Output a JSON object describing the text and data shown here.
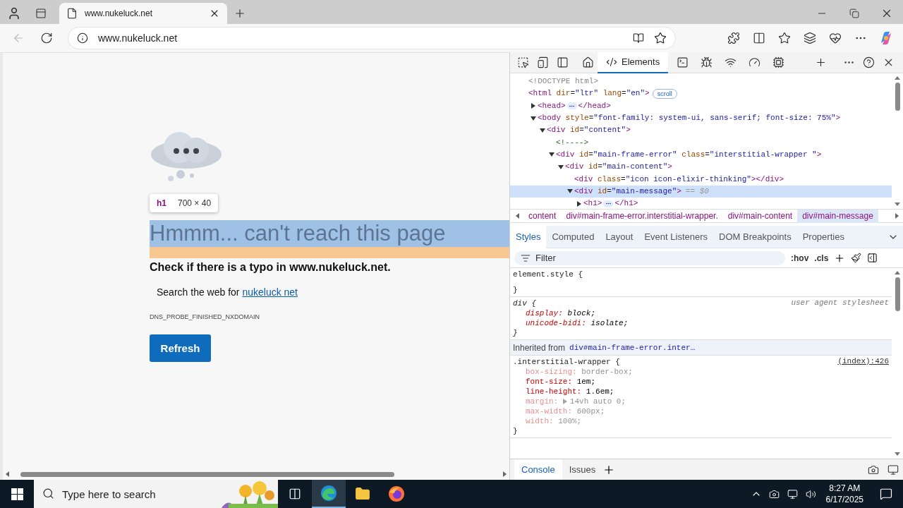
{
  "browser": {
    "tab": {
      "title": "www.nukeluck.net",
      "selected": true
    },
    "address": "www.nukeluck.net"
  },
  "page": {
    "tooltip": {
      "tag": "h1",
      "size": "700 × 40"
    },
    "heading": "Hmmm... can't reach this page",
    "subheading": "Check if there is a typo in www.nukeluck.net.",
    "search_text": "Search the web for",
    "search_link": "nukeluck net",
    "error_code": "DNS_PROBE_FINISHED_NXDOMAIN",
    "button": "Refresh"
  },
  "devtools": {
    "tool_tabs": [
      {
        "label": "Elements",
        "selected": true
      }
    ],
    "dom_tree": [
      {
        "tokens": [
          {
            "kind": "doctype",
            "text": "<!DOCTYPE html>"
          }
        ]
      },
      {
        "tokens": [
          {
            "kind": "tag",
            "text": "<html"
          },
          {
            "kind": "attr",
            "text": "dir"
          },
          {
            "kind": "punct",
            "text": "="
          },
          {
            "kind": "value",
            "text": "\"ltr\""
          },
          {
            "kind": "attr",
            "text": "lang"
          },
          {
            "kind": "punct",
            "text": "="
          },
          {
            "kind": "value",
            "text": "\"en\""
          },
          {
            "kind": "tag",
            "text": ">"
          }
        ],
        "badge": "scroll",
        "children": [
          {
            "expanded": false,
            "tokens": [
              {
                "kind": "tag",
                "text": "<head>"
              },
              {
                "kind": "ellipsis"
              },
              {
                "kind": "tag",
                "text": "</head>"
              }
            ]
          },
          {
            "expanded": true,
            "tokens": [
              {
                "kind": "tag",
                "text": "<body"
              },
              {
                "kind": "attr",
                "text": "style"
              },
              {
                "kind": "punct",
                "text": "="
              },
              {
                "kind": "value",
                "text": "\"font-family: system-ui, sans-serif; font-size: 75%\""
              },
              {
                "kind": "tag",
                "text": ">"
              }
            ],
            "children": [
              {
                "expanded": true,
                "tokens": [
                  {
                    "kind": "tag",
                    "text": "<div"
                  },
                  {
                    "kind": "attr",
                    "text": "id"
                  },
                  {
                    "kind": "punct",
                    "text": "="
                  },
                  {
                    "kind": "value",
                    "text": "\"content\""
                  },
                  {
                    "kind": "tag",
                    "text": ">"
                  }
                ],
                "children": [
                  {
                    "tokens": [
                      {
                        "kind": "comment",
                        "text": "<!---->"
                      }
                    ]
                  },
                  {
                    "expanded": true,
                    "tokens": [
                      {
                        "kind": "tag",
                        "text": "<div"
                      },
                      {
                        "kind": "attr",
                        "text": "id"
                      },
                      {
                        "kind": "punct",
                        "text": "="
                      },
                      {
                        "kind": "value",
                        "text": "\"main-frame-error\""
                      },
                      {
                        "kind": "attr",
                        "text": "class"
                      },
                      {
                        "kind": "punct",
                        "text": "="
                      },
                      {
                        "kind": "value",
                        "text": "\"interstitial-wrapper \""
                      },
                      {
                        "kind": "tag",
                        "text": ">"
                      }
                    ],
                    "children": [
                      {
                        "expanded": true,
                        "tokens": [
                          {
                            "kind": "tag",
                            "text": "<div"
                          },
                          {
                            "kind": "attr",
                            "text": "id"
                          },
                          {
                            "kind": "punct",
                            "text": "="
                          },
                          {
                            "kind": "value",
                            "text": "\"main-content\""
                          },
                          {
                            "kind": "tag",
                            "text": ">"
                          }
                        ],
                        "children": [
                          {
                            "tokens": [
                              {
                                "kind": "tag",
                                "text": "<div"
                              },
                              {
                                "kind": "attr",
                                "text": "class"
                              },
                              {
                                "kind": "punct",
                                "text": "="
                              },
                              {
                                "kind": "value",
                                "text": "\"icon icon-elixir-thinking\""
                              },
                              {
                                "kind": "tag",
                                "text": "></div>"
                              }
                            ]
                          },
                          {
                            "expanded": true,
                            "selected": true,
                            "suffix": "== $0",
                            "tokens": [
                              {
                                "kind": "tag",
                                "text": "<div"
                              },
                              {
                                "kind": "attr",
                                "text": "id"
                              },
                              {
                                "kind": "punct",
                                "text": "="
                              },
                              {
                                "kind": "value",
                                "text": "\"main-message\""
                              },
                              {
                                "kind": "tag",
                                "text": ">"
                              }
                            ],
                            "children": [
                              {
                                "expanded": false,
                                "tokens": [
                                  {
                                    "kind": "tag",
                                    "text": "<h1>"
                                  },
                                  {
                                    "kind": "ellipsis"
                                  },
                                  {
                                    "kind": "tag",
                                    "text": "</h1>"
                                  }
                                ]
                              }
                            ]
                          }
                        ]
                      }
                    ]
                  }
                ]
              }
            ]
          }
        ]
      }
    ],
    "breadcrumbs": [
      {
        "label": "content",
        "selected": false
      },
      {
        "label": "div#main-frame-error.interstitial-wrapper.",
        "selected": false
      },
      {
        "label": "div#main-content",
        "selected": false
      },
      {
        "label": "div#main-message",
        "selected": true
      }
    ],
    "panel_tabs": [
      {
        "label": "Styles",
        "selected": true
      },
      {
        "label": "Computed",
        "selected": false
      },
      {
        "label": "Layout",
        "selected": false
      },
      {
        "label": "Event Listeners",
        "selected": false
      },
      {
        "label": "DOM Breakpoints",
        "selected": false
      },
      {
        "label": "Properties",
        "selected": false
      }
    ],
    "filter": {
      "placeholder": "Filter"
    },
    "hov": ":hov",
    "cls": ".cls",
    "styles": [
      {
        "kind": "rule",
        "selector": "element.style {",
        "close": "}"
      },
      {
        "kind": "ua_rule",
        "selector": "div {",
        "origin": "user agent stylesheet",
        "close": "}",
        "properties": [
          {
            "name": "display:",
            "value": "block;",
            "overridden": false
          },
          {
            "name": "unicode-bidi:",
            "value": "isolate;",
            "overridden": false
          }
        ]
      },
      {
        "kind": "inherited",
        "label": "Inherited from",
        "link": "div#main-frame-error.inter…"
      },
      {
        "kind": "rule",
        "selector": ".interstitial-wrapper {",
        "source": "(index):426",
        "close": "}",
        "properties": [
          {
            "name": "box-sizing:",
            "value": "border-box;",
            "overridden": true
          },
          {
            "name": "font-size:",
            "value": "1em;",
            "overridden": false
          },
          {
            "name": "line-height:",
            "value": "1.6em;",
            "overridden": false
          },
          {
            "name": "margin:",
            "value": "14vh auto 0;",
            "overridden": true,
            "expandable": true
          },
          {
            "name": "max-width:",
            "value": "600px;",
            "overridden": true
          },
          {
            "name": "width:",
            "value": "100%;",
            "overridden": true
          }
        ]
      }
    ],
    "drawer_tabs": [
      {
        "label": "Console",
        "selected": true
      },
      {
        "label": "Issues",
        "selected": false
      }
    ]
  },
  "taskbar": {
    "search_placeholder": "Type here to search",
    "time": "8:27 AM",
    "date": "6/17/2025"
  }
}
